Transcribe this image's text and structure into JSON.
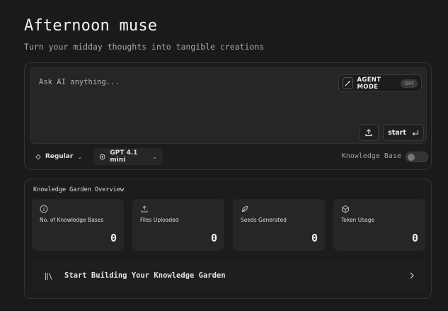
{
  "header": {
    "title": "Afternoon muse",
    "subtitle": "Turn your midday thoughts into tangible creations"
  },
  "composer": {
    "placeholder": "Ask AI anything...",
    "agent_mode": {
      "label": "AGENT MODE",
      "state": "OFF"
    },
    "start_label": "start",
    "style_option": "Regular",
    "model_option": "GPT 4.1 mini",
    "knowledge_base_label": "Knowledge Base",
    "knowledge_base_enabled": false
  },
  "garden": {
    "title": "Knowledge Garden Overview",
    "stats": [
      {
        "label": "No. of Knowledge Bases",
        "value": "0",
        "icon": "info-icon"
      },
      {
        "label": "Files Uploaded",
        "value": "0",
        "icon": "upload-icon"
      },
      {
        "label": "Seeds Generated",
        "value": "0",
        "icon": "seed-icon"
      },
      {
        "label": "Token Usage",
        "value": "0",
        "icon": "cube-icon"
      }
    ],
    "cta_label": "Start Building Your Knowledge Garden"
  },
  "colors": {
    "background": "#1a1a1a",
    "card": "#262626",
    "border": "#333333"
  }
}
